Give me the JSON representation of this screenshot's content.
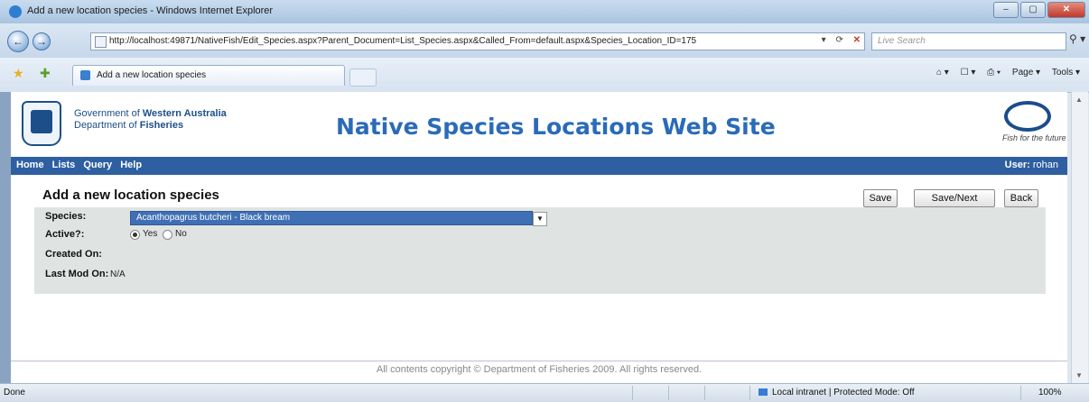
{
  "window": {
    "title": "Add a new location species - Windows Internet Explorer",
    "controls": [
      "–",
      "▢",
      "✕"
    ]
  },
  "browser": {
    "back_glyph": "←",
    "forward_glyph": "→",
    "url": "http://localhost:49871/NativeFish/Edit_Species.aspx?Parent_Document=List_Species.aspx&Called_From=default.aspx&Species_Location_ID=175",
    "search_placeholder": "Live Search",
    "search_glyph": "⚲ ▾",
    "addr_tools": "▾ ⟳",
    "stop_glyph": "✕",
    "tab_label": "Add a new location species",
    "commands": [
      "⌂ ▾",
      "☐ ▾",
      "⎙ ▾",
      "Page ▾",
      "Tools ▾"
    ]
  },
  "site": {
    "gov_line1": "Government of ",
    "gov_line1_bold": "Western Australia",
    "gov_line2": "Department of ",
    "gov_line2_bold": "Fisheries",
    "title": "Native Species Locations Web Site",
    "tagline": "Fish for the future",
    "menu": [
      "Home",
      "Lists",
      "Query",
      "Help"
    ],
    "user_label": "User:",
    "user_name": "rohan"
  },
  "form": {
    "title": "Add a new location species",
    "buttons": {
      "save": "Save",
      "save_next": "Save/Next",
      "back": "Back"
    },
    "species_label": "Species:",
    "species_value": "Acanthopagrus butcheri - Black bream",
    "select_arrow": "▼",
    "active_label": "Active?:",
    "active_options": [
      "Yes",
      "No"
    ],
    "active_selected": "Yes",
    "created_label": "Created On:",
    "created_value": "",
    "lastmod_label": "Last Mod On:",
    "lastmod_value": "N/A"
  },
  "footer": "All contents copyright © Department of Fisheries 2009. All rights reserved.",
  "status": {
    "left": "Done",
    "zone": "Local intranet | Protected Mode: Off",
    "zoom": "100%"
  }
}
